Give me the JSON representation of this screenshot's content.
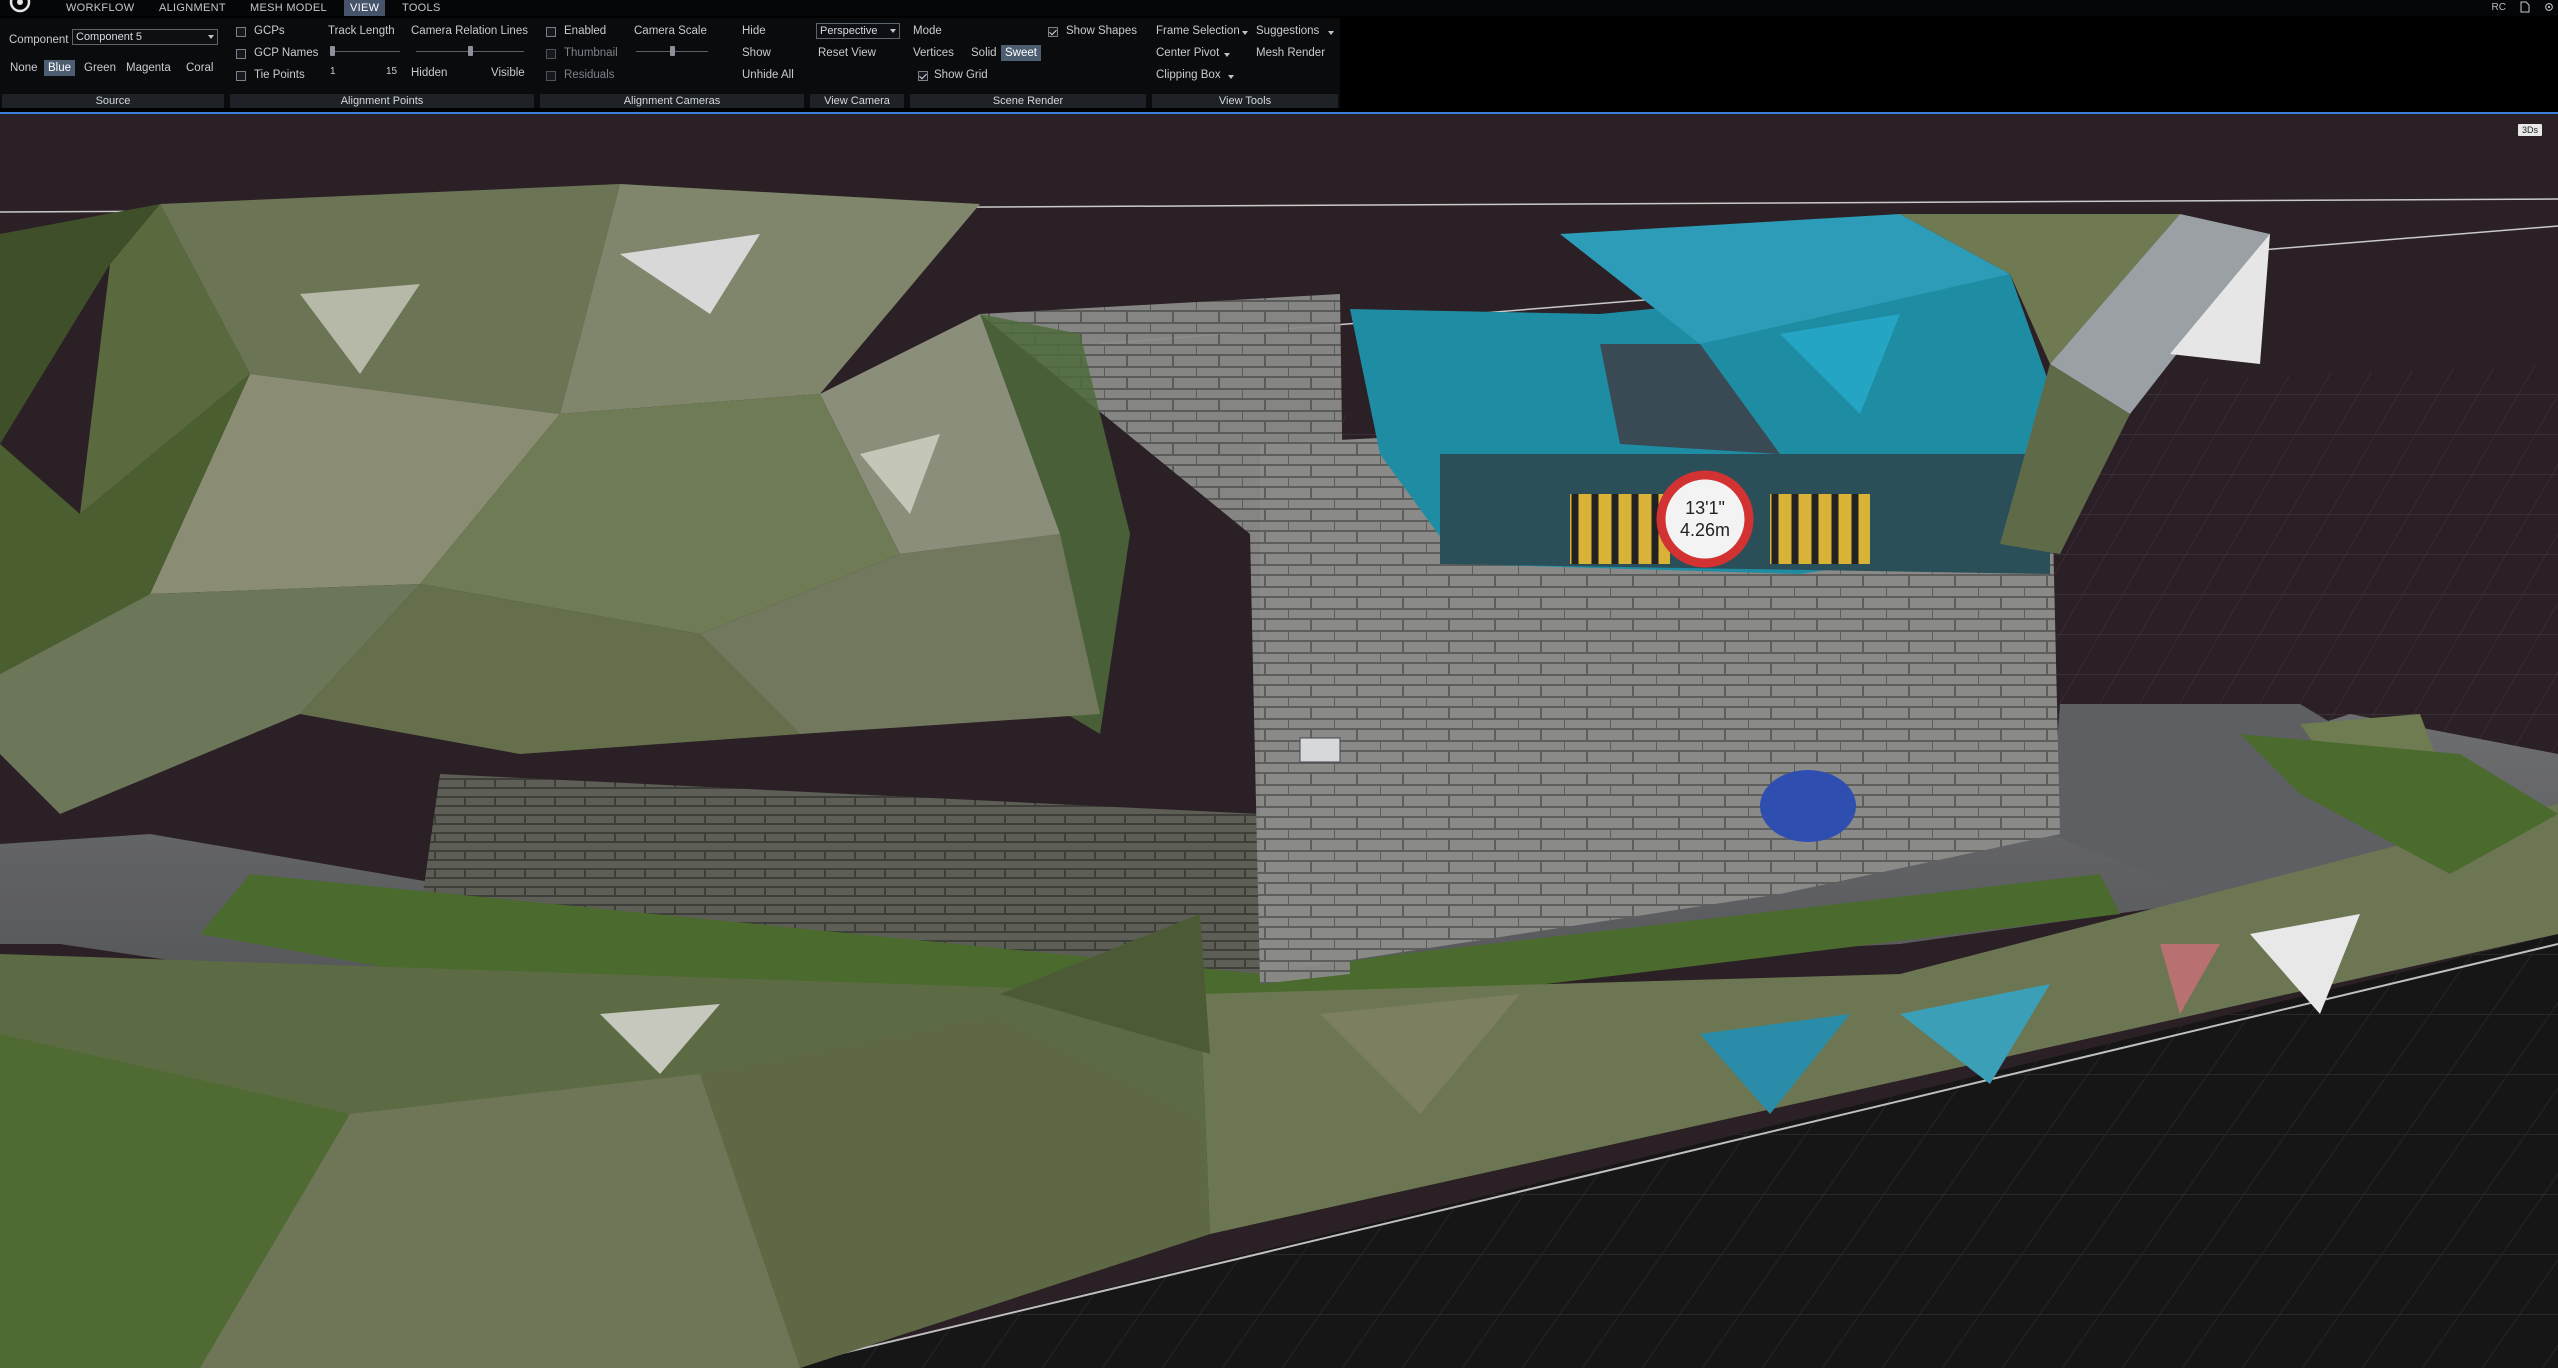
{
  "menubar": {
    "tabs": [
      {
        "label": "WORKFLOW"
      },
      {
        "label": "ALIGNMENT"
      },
      {
        "label": "MESH MODEL"
      },
      {
        "label": "VIEW"
      },
      {
        "label": "TOOLS"
      }
    ],
    "active_tab": "VIEW",
    "right_label": "RC"
  },
  "ribbon": {
    "source": {
      "title": "Source",
      "component_label": "Component",
      "component_value": "Component 5",
      "colors": [
        "None",
        "Blue",
        "Green",
        "Magenta",
        "Coral"
      ],
      "active_color": "Blue"
    },
    "alignment_points": {
      "title": "Alignment Points",
      "gcps": "GCPs",
      "gcp_names": "GCP Names",
      "tie_points": "Tie Points",
      "track_length": "Track Length",
      "track_min": "1",
      "track_max": "15",
      "camera_relation_lines": "Camera Relation Lines",
      "hidden": "Hidden",
      "visible": "Visible"
    },
    "alignment_cameras": {
      "title": "Alignment Cameras",
      "enabled": "Enabled",
      "thumbnail": "Thumbnail",
      "residuals": "Residuals",
      "camera_scale": "Camera Scale",
      "hide": "Hide",
      "show": "Show",
      "unhide_all": "Unhide All"
    },
    "view_camera": {
      "title": "View Camera",
      "projection": "Perspective",
      "reset_view": "Reset View"
    },
    "scene_render": {
      "title": "Scene Render",
      "mode": "Mode",
      "modes": [
        "Vertices",
        "Solid",
        "Sweet"
      ],
      "active_mode": "Sweet",
      "show_shapes": "Show Shapes",
      "show_grid": "Show Grid"
    },
    "view_tools": {
      "title": "View Tools",
      "frame_selection": "Frame Selection",
      "suggestions": "Suggestions",
      "center_pivot": "Center Pivot",
      "mesh_render": "Mesh Render",
      "clipping_box": "Clipping Box"
    }
  },
  "viewport": {
    "badge": "3Ds",
    "sign_line1": "13'1\"",
    "sign_line2": "4.26m"
  },
  "colors": {
    "accent": "#3d7fd8",
    "active_tab": "#45546a",
    "active_pill": "#4d5d72",
    "sky": "#2a2024",
    "floor": "#141414",
    "mesh_teal": "#2aa0c0",
    "mesh_olive": "#6b7a52"
  }
}
